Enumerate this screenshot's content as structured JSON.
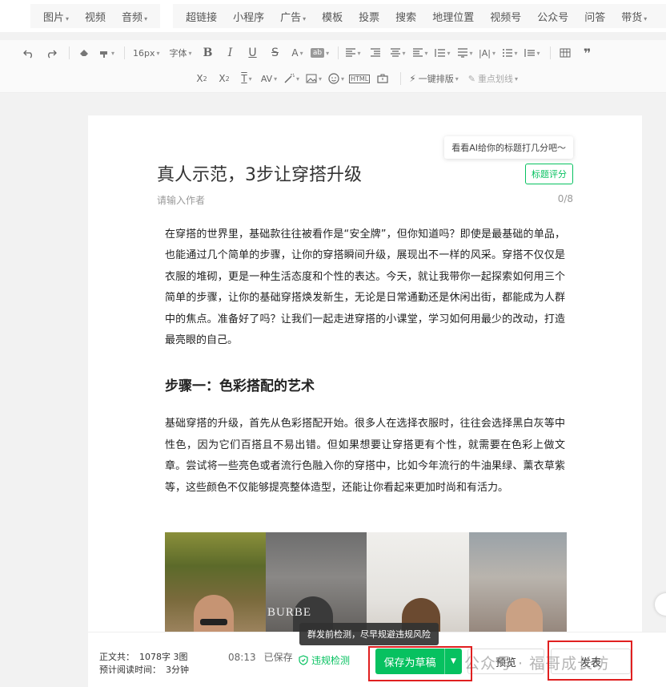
{
  "insert_bar": {
    "group1": [
      {
        "label": "图片",
        "caret": true
      },
      {
        "label": "视频",
        "caret": false
      },
      {
        "label": "音频",
        "caret": true
      }
    ],
    "group2": [
      {
        "label": "超链接",
        "caret": false
      },
      {
        "label": "小程序",
        "caret": false
      },
      {
        "label": "广告",
        "caret": true
      },
      {
        "label": "模板",
        "caret": false
      },
      {
        "label": "投票",
        "caret": false
      },
      {
        "label": "搜索",
        "caret": false
      },
      {
        "label": "地理位置",
        "caret": false
      },
      {
        "label": "视频号",
        "caret": false
      },
      {
        "label": "公众号",
        "caret": false
      },
      {
        "label": "问答",
        "caret": false
      },
      {
        "label": "带货",
        "caret": true
      }
    ]
  },
  "toolbar": {
    "font_size": "16px",
    "font_family": "字体",
    "one_click_format": "一键排版",
    "key_highlight": "重点划线"
  },
  "article": {
    "ai_tip": "看看AI给你的标题打几分吧～",
    "title_score_button": "标题评分",
    "title": "真人示范，3步让穿搭升级",
    "author_placeholder": "请输入作者",
    "author_counter": "0/8",
    "paragraph1": "在穿搭的世界里，基础款往往被看作是“安全牌”，但你知道吗？即使是最基础的单品，也能通过几个简单的步骤，让你的穿搭瞬间升级，展现出不一样的风采。穿搭不仅仅是衣服的堆砌，更是一种生活态度和个性的表达。今天，就让我带你一起探索如何用三个简单的步骤，让你的基础穿搭焕发新生，无论是日常通勤还是休闲出街，都能成为人群中的焦点。准备好了吗？让我们一起走进穿搭的小课堂，学习如何用最少的改动，打造最亮眼的自己。",
    "heading1": "步骤一：色彩搭配的艺术",
    "paragraph2": "基础穿搭的升级，首先从色彩搭配开始。很多人在选择衣服时，往往会选择黑白灰等中性色，因为它们百搭且不易出错。但如果想要让穿搭更有个性，就需要在色彩上做文章。尝试将一些亮色或者流行色融入你的穿搭中，比如今年流行的牛油果绿、薰衣草紫等，这些颜色不仅能够提亮整体造型，还能让你看起来更加时尚和有活力。",
    "photo_sign": "BURBE"
  },
  "bottom_bar": {
    "word_count_label": "正文共：",
    "word_count": "1078字 3图",
    "read_time_label": "预计阅读时间：",
    "read_time": "3分钟",
    "save_time": "08:13",
    "save_status": "已保存",
    "compliance_check": "违规检测",
    "tooltip": "群发前检测，尽早规避违规风险",
    "save_draft": "保存为草稿",
    "preview": "预览",
    "publish": "发表",
    "watermark": "公众号 · 福哥成长坊"
  },
  "colors": {
    "accent_green": "#07c160",
    "highlight_red": "#e02020"
  }
}
